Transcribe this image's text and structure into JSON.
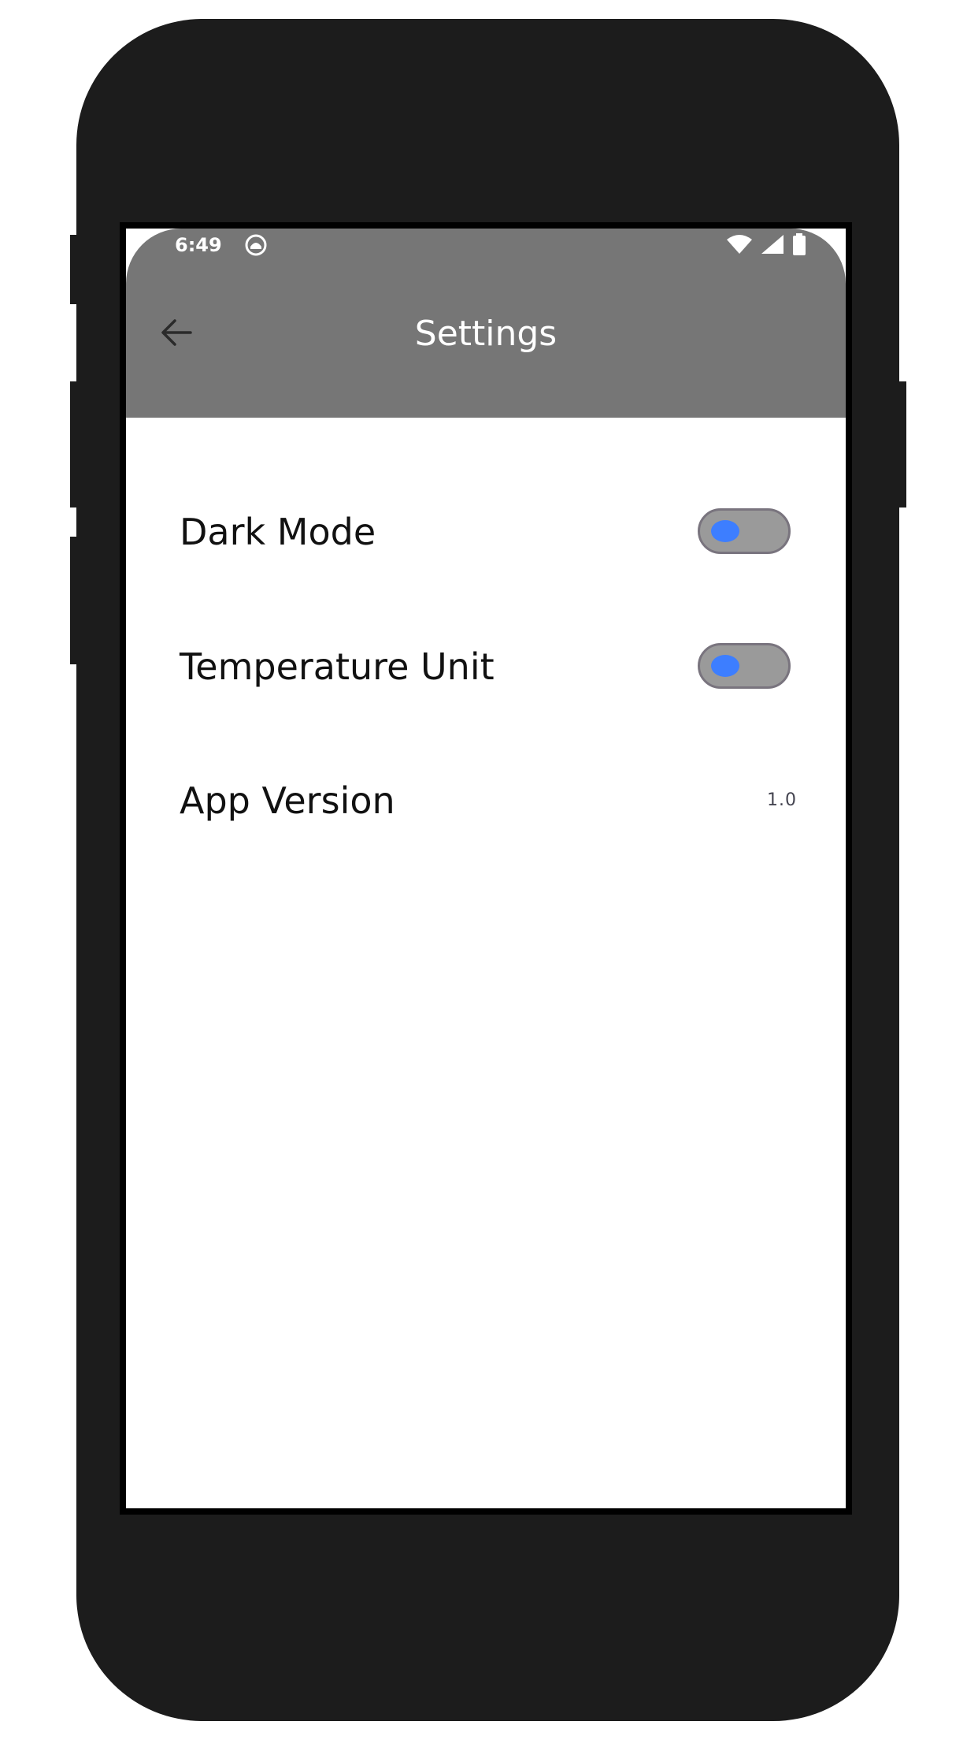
{
  "status_bar": {
    "time": "6:49",
    "notification_icon": "android-notification-icon",
    "icons": [
      "wifi-icon",
      "cellular-signal-icon",
      "battery-icon"
    ]
  },
  "app_bar": {
    "back_icon": "arrow-left-icon",
    "title": "Settings",
    "background_color": "#767676"
  },
  "settings": {
    "dark_mode": {
      "label": "Dark Mode",
      "toggle_on": false
    },
    "temperature_unit": {
      "label": "Temperature Unit",
      "toggle_on": false
    },
    "app_version": {
      "label": "App Version",
      "value": "1.0"
    }
  },
  "colors": {
    "toggle_track": "#9a9a9a",
    "toggle_border": "#79747e",
    "toggle_knob": "#3d7eff",
    "text": "#111111"
  }
}
